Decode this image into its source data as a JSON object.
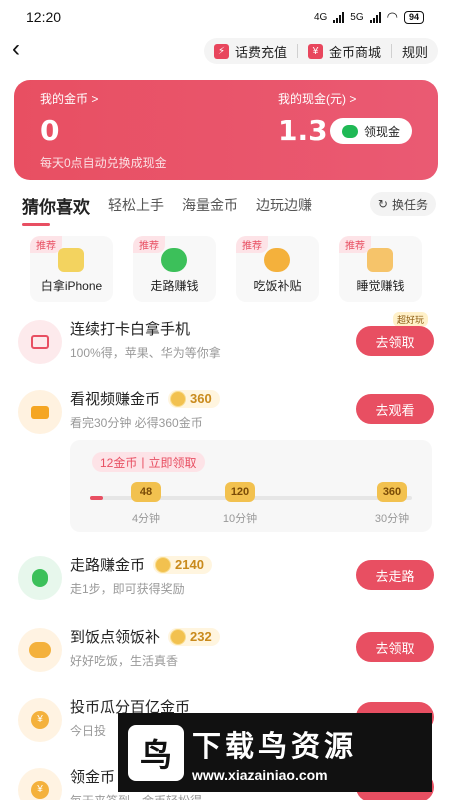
{
  "status_bar": {
    "time": "12:20",
    "network1": "4G",
    "network2": "5G",
    "battery": "94"
  },
  "header": {
    "actions": [
      {
        "label": "话费充值",
        "icon": "phone-recharge-icon"
      },
      {
        "label": "金币商城",
        "icon": "store-icon"
      },
      {
        "label": "规则"
      }
    ]
  },
  "balance_card": {
    "coin_label": "我的金币 >",
    "coin_value": "0",
    "cash_label": "我的现金(元) >",
    "cash_value": "1.3",
    "withdraw_label": "领现金",
    "note": "每天0点自动兑换成现金"
  },
  "tabs": [
    "猜你喜欢",
    "轻松上手",
    "海量金币",
    "边玩边赚"
  ],
  "switch_label": "换任务",
  "recommend_cards": [
    {
      "tag": "推荐",
      "name": "白拿iPhone",
      "icon": "phone-icon",
      "color": "#f3d35f"
    },
    {
      "tag": "推荐",
      "name": "走路赚钱",
      "icon": "walking-icon",
      "color": "#3cc05a"
    },
    {
      "tag": "推荐",
      "name": "吃饭补贴",
      "icon": "food-bowl-icon",
      "color": "#f4b13c"
    },
    {
      "tag": "推荐",
      "name": "睡觉赚钱",
      "icon": "sleep-icon",
      "color": "#f6c46a"
    }
  ],
  "tasks": [
    {
      "title": "连续打卡白拿手机",
      "sub": "100%得，苹果、华为等你拿",
      "button": "去领取",
      "badge_tag": "超好玩",
      "coins": "",
      "icon": "gift-box-icon",
      "icon_bg": "#fdeaec",
      "icon_color": "#e84f62"
    },
    {
      "title": "看视频赚金币",
      "sub": "看完30分钟 必得360金币",
      "button": "去观看",
      "coins": "360",
      "icon": "video-camera-icon",
      "icon_bg": "#fff2e0",
      "icon_color": "#f5a623"
    },
    {
      "title": "走路赚金币",
      "sub": "走1步，即可获得奖励",
      "button": "去走路",
      "coins": "2140",
      "icon": "walking-icon",
      "icon_bg": "#e7f7ec",
      "icon_color": "#3cc05a"
    },
    {
      "title": "到饭点领饭补",
      "sub": "好好吃饭，生活真香",
      "button": "去领取",
      "coins": "232",
      "icon": "food-bowl-icon",
      "icon_bg": "#fff3e2",
      "icon_color": "#f4b13c"
    },
    {
      "title": "投币瓜分百亿金币",
      "sub": "今日投",
      "button": "",
      "coins": "",
      "icon": "coin-icon",
      "icon_bg": "#fff3e2",
      "icon_color": "#f4b13c"
    },
    {
      "title": "领金币",
      "sub": "每天来签到，金币轻松得",
      "button": "",
      "coins": "",
      "icon": "coin-icon",
      "icon_bg": "#fff3e2",
      "icon_color": "#f4b13c"
    }
  ],
  "video_progress": {
    "tag_coins": "12金币",
    "tag_action": "立即领取",
    "progress_fraction": 0.04,
    "milestones": [
      {
        "coins": "48",
        "label": "4分钟"
      },
      {
        "coins": "120",
        "label": "10分钟"
      },
      {
        "coins": "360",
        "label": "30分钟"
      }
    ]
  },
  "watermark": {
    "title": "下载鸟资源",
    "url": "www.xiazainiao.com"
  }
}
